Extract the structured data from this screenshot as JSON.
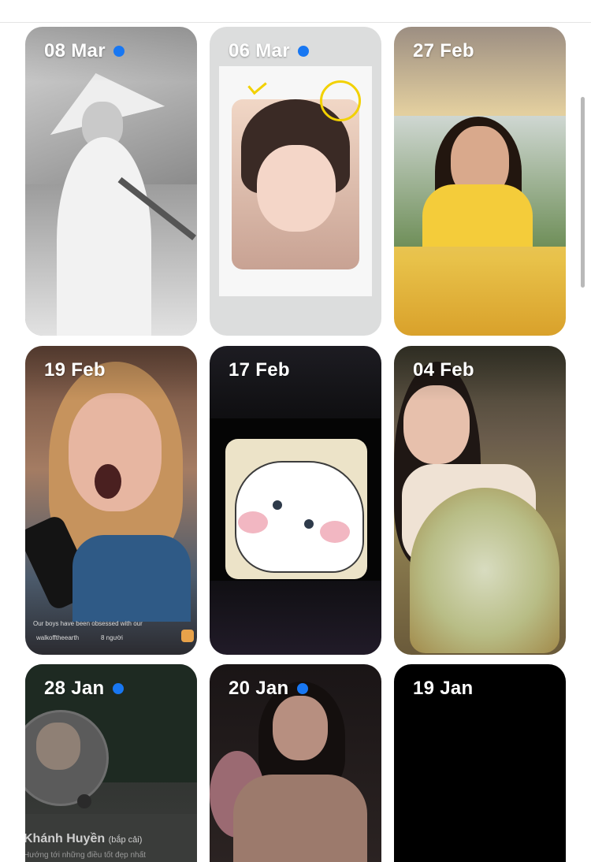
{
  "colors": {
    "unseen_dot": "#1877f2"
  },
  "stories": [
    {
      "date": "08 Mar",
      "unseen": true
    },
    {
      "date": "06 Mar",
      "unseen": true
    },
    {
      "date": "27 Feb",
      "unseen": false
    },
    {
      "date": "19 Feb",
      "unseen": false
    },
    {
      "date": "17 Feb",
      "unseen": false
    },
    {
      "date": "04 Feb",
      "unseen": false
    },
    {
      "date": "28 Jan",
      "unseen": true
    },
    {
      "date": "20 Jan",
      "unseen": true
    },
    {
      "date": "19 Jan",
      "unseen": false
    }
  ],
  "story_19feb": {
    "caption": "Our boys have been obsessed with our",
    "footer_user": "walkofftheearth",
    "footer_viewers": "8 người"
  },
  "story_28jan": {
    "profile_name": "Khánh Huyền",
    "profile_nickname": "(bắp cải)",
    "profile_bio": "Hướng tới những điều tốt đẹp nhất"
  }
}
